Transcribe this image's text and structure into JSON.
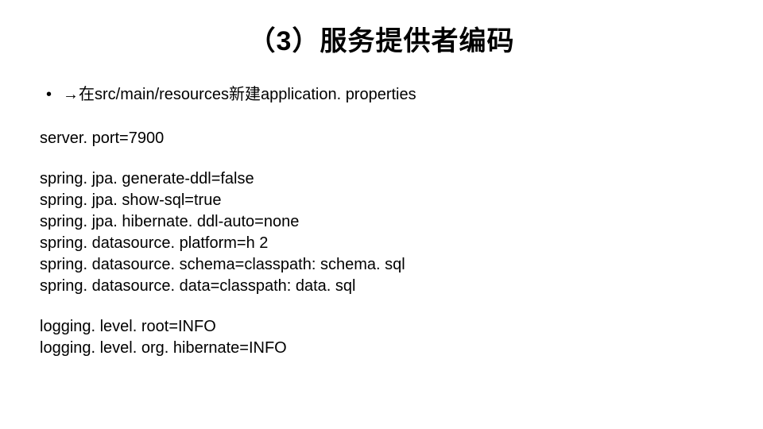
{
  "title": "（3）服务提供者编码",
  "bullet": {
    "marker": "•",
    "text": "→在src/main/resources新建application. properties"
  },
  "block1": {
    "line0": "server. port=7900"
  },
  "block2": {
    "line0": "spring. jpa. generate-ddl=false",
    "line1": "spring. jpa. show-sql=true",
    "line2": "spring. jpa. hibernate. ddl-auto=none",
    "line3": "spring. datasource. platform=h 2",
    "line4": "spring. datasource. schema=classpath: schema. sql",
    "line5": "spring. datasource. data=classpath: data. sql"
  },
  "block3": {
    "line0": "logging. level. root=INFO",
    "line1": "logging. level. org. hibernate=INFO"
  }
}
